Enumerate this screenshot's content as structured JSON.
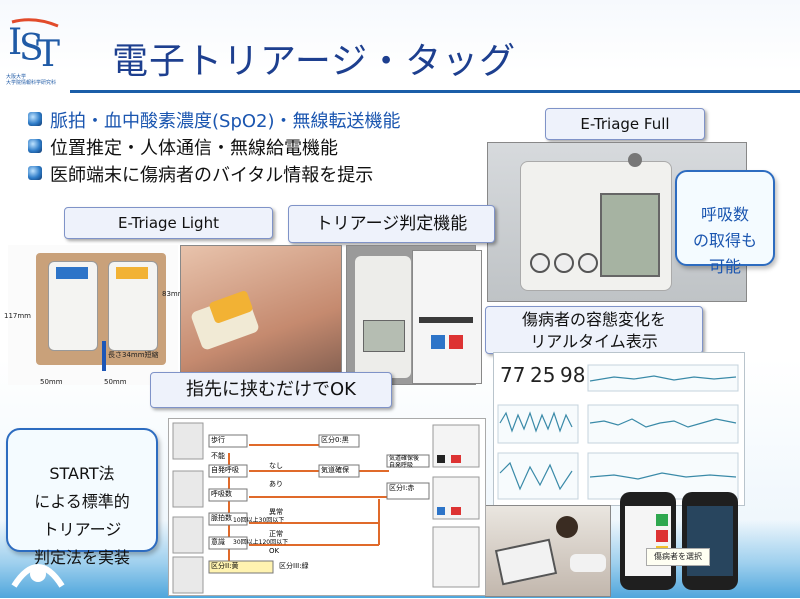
{
  "slide": {
    "title": "電子トリアージ・タッグ",
    "logo": {
      "letters": "IST",
      "subtext": "大阪大学\n大学院情報科学研究科"
    }
  },
  "bullets": [
    {
      "text": "脈拍・血中酸素濃度(SpO2)・無線転送機能",
      "highlight": "脈拍・血中酸素濃度(SpO2)"
    },
    {
      "text": "位置推定・人体通信・無線給電機能"
    },
    {
      "text": "医師端末に傷病者のバイタル情報を提示"
    }
  ],
  "labels": {
    "etriage_full": "E-Triage Full",
    "etriage_light": "E-Triage Light",
    "triage_judgement": "トリアージ判定機能",
    "finger_ok": "指先に挟むだけでOK",
    "patient_change": "傷病者の容態変化を\nリアルタイム表示",
    "breath_count": "呼吸数\nの取得も\n可能",
    "start_method": "START法\nによる標準的\nトリアージ\n判定法を実装",
    "select_patient": "傷病者を選択"
  },
  "light_dims": {
    "height": "117mm",
    "height2": "83mm",
    "width_a": "50mm",
    "width_b": "50mm",
    "depth": "長さ34mm短縮"
  },
  "vitals": {
    "values": [
      "77",
      "25",
      "98"
    ]
  },
  "flowchart": {
    "nodes": [
      "歩行",
      "不能",
      "自発呼吸",
      "呼吸数",
      "脈拍数",
      "意識",
      "区分0:黒",
      "気道確保",
      "区分I:赤",
      "区分II:黄",
      "区分III:緑"
    ],
    "labels": [
      "なし",
      "あり",
      "異常",
      "正常",
      "10回以上30回以下",
      "30回以上120回以下",
      "OK",
      "気道確保後\n自発呼吸"
    ]
  },
  "colors": {
    "title": "#1d3f8f",
    "rule": "#1b5ea8",
    "pill_border": "#7f93c8",
    "callout_border": "#2d6cc0",
    "flow_arrow": "#e06a2a"
  }
}
